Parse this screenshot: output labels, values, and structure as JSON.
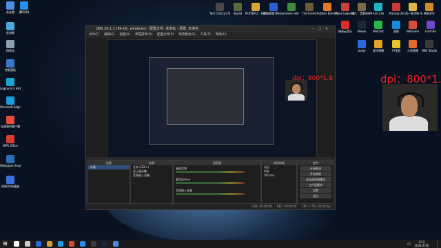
{
  "desktop_icons": [
    {
      "label": "亲友圈",
      "color": "#4d8fe0"
    },
    {
      "label": "此电脑",
      "color": "#4fa7e0"
    },
    {
      "label": "回收站",
      "color": "#8ca0b0"
    },
    {
      "label": "控制面板",
      "color": "#3a77c9"
    },
    {
      "label": "Logitech G HUB",
      "color": "#1aa5d4"
    },
    {
      "label": "Microsoft Edge",
      "color": "#1e9be0"
    },
    {
      "label": "无畏契约客户端",
      "color": "#e84a3c"
    },
    {
      "label": "WPS Office",
      "color": "#d93a2e"
    },
    {
      "label": "Wallpaper Engine:...",
      "color": "#2d6db0"
    },
    {
      "label": "网易UU加速器",
      "color": "#3c6ee0"
    },
    {
      "label": "腾讯QQ",
      "color": "#2c8ee8"
    },
    {
      "label": "Tom Clancy's R...",
      "color": "#4a4a4a"
    },
    {
      "label": "Squad",
      "color": "#5a6a3a"
    },
    {
      "label": "PLAYERU... BATTLEGR...",
      "color": "#d9a13a"
    },
    {
      "label": "英雄联盟 WeGame",
      "color": "#2e5fd0"
    },
    {
      "label": "Green Hell",
      "color": "#3c8a3c"
    },
    {
      "label": "The Forest",
      "color": "#6a5a3a"
    },
    {
      "label": "Rubber Bandits",
      "color": "#e07a2a"
    },
    {
      "label": "Apex Legends",
      "color": "#c8423a"
    },
    {
      "label": "猎人：荒野的呼唤",
      "color": "#7a6a4a"
    },
    {
      "label": "Aim Lab",
      "color": "#1fb3c8"
    },
    {
      "label": "Among Us",
      "color": "#c83a3a"
    },
    {
      "label": "人类一败涂地 Human Fa...",
      "color": "#e0b84a"
    },
    {
      "label": "绝地求生",
      "color": "#d08a2a"
    },
    {
      "label": "Fortnite",
      "color": "#6a4ac8"
    },
    {
      "label": "WeChat",
      "color": "#2ab84a"
    },
    {
      "label": "战网",
      "color": "#1d8ae0"
    },
    {
      "label": "WeGame",
      "color": "#d94a3a"
    },
    {
      "label": "Steam",
      "color": "#1b2838"
    },
    {
      "label": "网易云音乐",
      "color": "#d92e2e"
    },
    {
      "label": "OBS Studio",
      "color": "#3a3a3a"
    },
    {
      "label": "YY语音",
      "color": "#e8c22a"
    },
    {
      "label": "斗鱼直播",
      "color": "#e06a2a"
    },
    {
      "label": "虎牙直播",
      "color": "#e0a22a"
    },
    {
      "label": "Uplay",
      "color": "#2a6ae0"
    }
  ],
  "obs": {
    "title": "OBS 26.1.1 (64-bit, windows) - 配置文件: 未命名 - 场景: 未命名",
    "menu": [
      "文件(F)",
      "编辑(E)",
      "视图(V)",
      "停靠部件(D)",
      "配置文件(P)",
      "场景集合(S)",
      "工具(T)",
      "帮助(H)"
    ],
    "dock": {
      "scenes_header": "场景",
      "scenes": [
        "场景"
      ],
      "sources_header": "来源",
      "sources": [
        "文本 (GDI+)",
        "显示器采集",
        "音频输入采集"
      ],
      "mixer_header": "混音器",
      "mixer": [
        {
          "name": "桌面音频",
          "db": "0.0 dB"
        },
        {
          "name": "麦克风/Aux",
          "db": "0.0 dB"
        },
        {
          "name": "音频输入采集",
          "db": "0.0 dB"
        }
      ],
      "transitions_header": "转场特效",
      "transition_value": "淡出",
      "duration_label": "时长",
      "duration_value": "300 ms",
      "controls_header": "控件",
      "controls": [
        "开始推流",
        "开始录制",
        "启动虚拟摄像机",
        "工作室模式",
        "设置",
        "退出"
      ]
    },
    "status": {
      "live": "LIVE: 00:00:00",
      "rec": "REC: 00:00:00",
      "cpu": "CPU: 1.5%, 60.00 fps"
    }
  },
  "cam_overlay_large": {
    "dpi_text": "dpi：800*1.8"
  },
  "cam_overlay_small": {
    "dpi_text": "dpi：800*1.8"
  },
  "taskbar": {
    "time": "3:12",
    "date": "2021/7/16",
    "lang": "中",
    "apps": [
      {
        "color": "#ffffff"
      },
      {
        "color": "#cccccc"
      },
      {
        "color": "#2a6ae0"
      },
      {
        "color": "#d9a13a"
      },
      {
        "color": "#1e9be0"
      },
      {
        "color": "#d94a3a"
      },
      {
        "color": "#2c8ee8"
      },
      {
        "color": "#3a3a3a"
      },
      {
        "color": "#1b2838"
      },
      {
        "color": "#4a8ae0"
      }
    ]
  }
}
